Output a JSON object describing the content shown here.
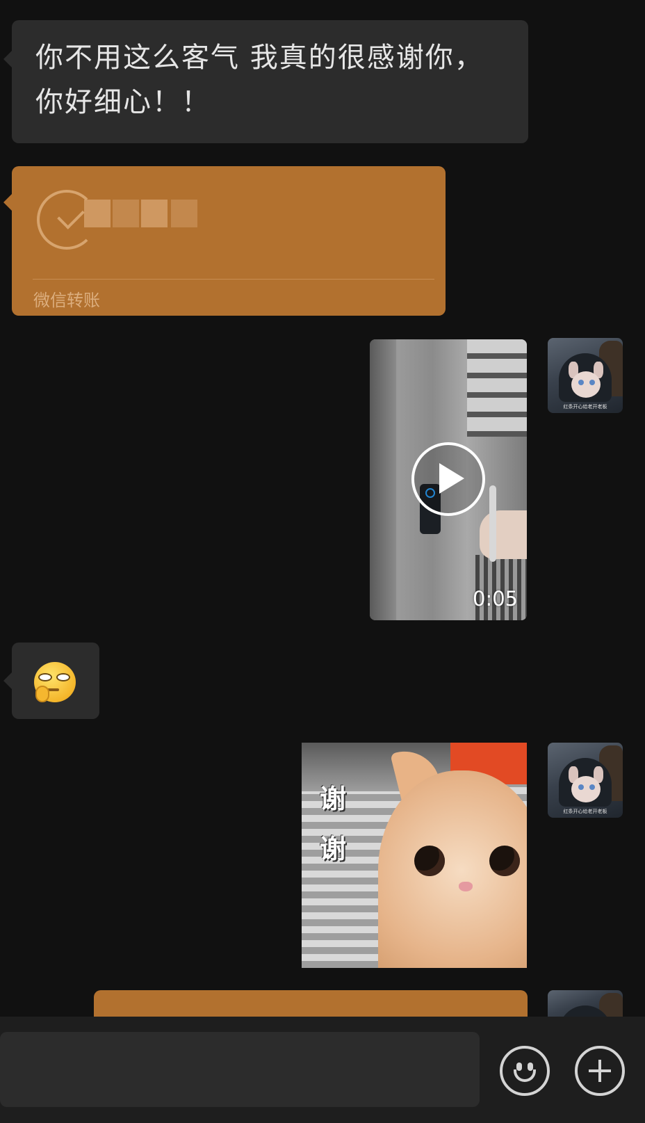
{
  "messages": {
    "incoming_text": "你不用这么客气 我真的很感谢你，你好细心！！",
    "transfer_label": "微信转账",
    "video_duration": "0:05",
    "sticker_caption_1": "谢",
    "sticker_caption_2": "谢"
  },
  "avatar": {
    "caption": "红条开心给老开老板"
  },
  "icons": {
    "emoji": "smile-icon",
    "more": "plus-icon",
    "video": "play-icon"
  },
  "colors": {
    "background": "#111111",
    "incoming_bubble": "#2c2c2c",
    "transfer_card": "#b2712f"
  }
}
